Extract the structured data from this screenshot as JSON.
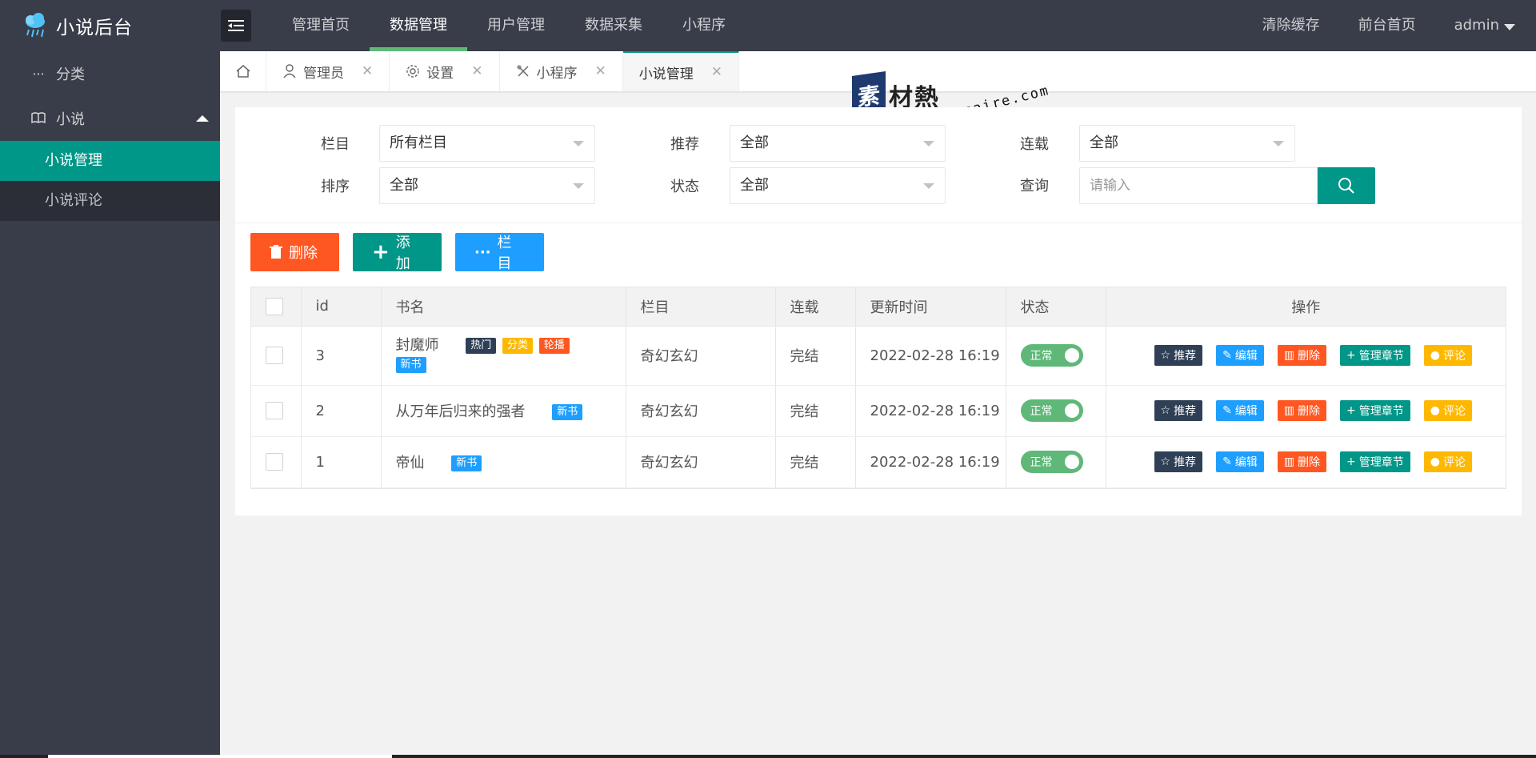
{
  "app": {
    "title": "小说后台"
  },
  "top_nav": [
    "管理首页",
    "数据管理",
    "用户管理",
    "数据采集",
    "小程序"
  ],
  "right_nav": {
    "clear_cache": "清除缓存",
    "front_home": "前台首页",
    "user": "admin"
  },
  "sidebar": {
    "category": "分类",
    "novel": "小说",
    "sub_items": [
      "小说管理",
      "小说评论"
    ]
  },
  "tabs": [
    {
      "label": "管理员",
      "icon": "user-icon"
    },
    {
      "label": "设置",
      "icon": "gear-icon"
    },
    {
      "label": "小程序",
      "icon": "tools-icon"
    },
    {
      "label": "小说管理",
      "icon": ""
    }
  ],
  "watermark": {
    "brand": "素材熱",
    "url": "sucaire.com"
  },
  "filters": {
    "column": {
      "label": "栏目",
      "value": "所有栏目"
    },
    "recommend": {
      "label": "推荐",
      "value": "全部"
    },
    "serial": {
      "label": "连载",
      "value": "全部"
    },
    "sort": {
      "label": "排序",
      "value": "全部"
    },
    "status": {
      "label": "状态",
      "value": "全部"
    },
    "query": {
      "label": "查询",
      "placeholder": "请输入"
    }
  },
  "toolbar": {
    "delete": "删除",
    "add": "添加",
    "column": "栏目"
  },
  "table": {
    "headers": [
      "id",
      "书名",
      "栏目",
      "连载",
      "更新时间",
      "状态",
      "操作"
    ],
    "rows": [
      {
        "id": "3",
        "name": "封魔师",
        "tags": [
          "热门",
          "分类",
          "轮播",
          "新书"
        ],
        "column": "奇幻玄幻",
        "serial": "完结",
        "updated": "2022-02-28 16:19",
        "status": "正常"
      },
      {
        "id": "2",
        "name": "从万年后归来的强者",
        "tags": [
          "新书"
        ],
        "column": "奇幻玄幻",
        "serial": "完结",
        "updated": "2022-02-28 16:19",
        "status": "正常"
      },
      {
        "id": "1",
        "name": "帝仙",
        "tags": [
          "新书"
        ],
        "column": "奇幻玄幻",
        "serial": "完结",
        "updated": "2022-02-28 16:19",
        "status": "正常"
      }
    ],
    "ops": {
      "recommend": "推荐",
      "edit": "编辑",
      "delete": "删除",
      "chapters": "管理章节",
      "comment": "评论"
    }
  },
  "colors": {
    "primary": "#009688",
    "danger": "#ff5722",
    "info": "#1e9fff",
    "warn": "#ffb800",
    "dark": "#2f4056",
    "header": "#393d49",
    "switch": "#5fb878"
  }
}
